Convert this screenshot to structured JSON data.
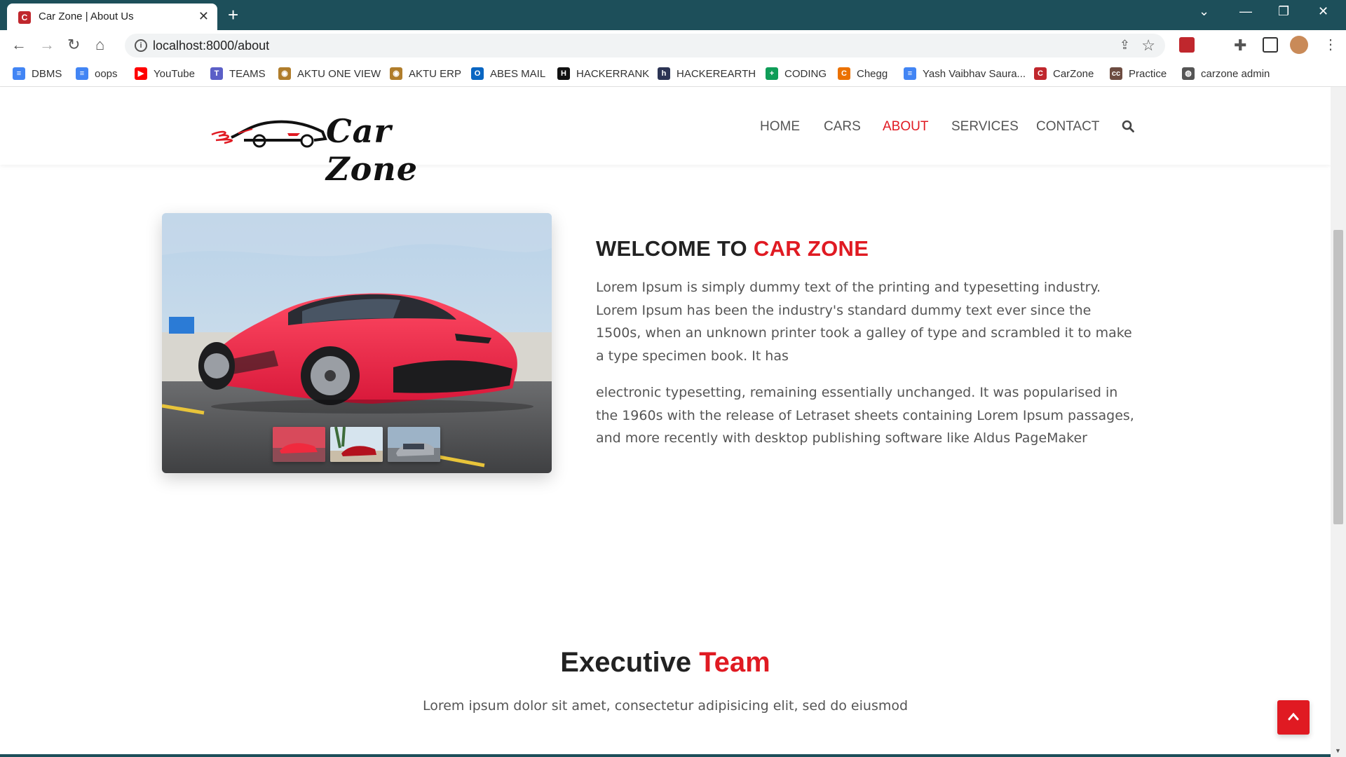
{
  "browser": {
    "tab_title": "Car Zone | About Us",
    "url": "localhost:8000/about",
    "bookmarks": [
      {
        "label": "DBMS",
        "color": "#4285f4",
        "glyph": "≡"
      },
      {
        "label": "oops",
        "color": "#4285f4",
        "glyph": "≡"
      },
      {
        "label": "YouTube",
        "color": "#ff0000",
        "glyph": "▶"
      },
      {
        "label": "TEAMS",
        "color": "#5b5fc7",
        "glyph": "T"
      },
      {
        "label": "AKTU ONE VIEW",
        "color": "#b07d2b",
        "glyph": "◉"
      },
      {
        "label": "AKTU ERP",
        "color": "#b07d2b",
        "glyph": "◉"
      },
      {
        "label": "ABES MAIL",
        "color": "#0a66c2",
        "glyph": "O"
      },
      {
        "label": "HACKERRANK",
        "color": "#111111",
        "glyph": "H"
      },
      {
        "label": "HACKEREARTH",
        "color": "#2c3454",
        "glyph": "h"
      },
      {
        "label": "CODING",
        "color": "#0f9d58",
        "glyph": "+"
      },
      {
        "label": "Chegg",
        "color": "#eb7100",
        "glyph": "C"
      },
      {
        "label": "Yash Vaibhav Saura...",
        "color": "#4285f4",
        "glyph": "≡"
      },
      {
        "label": "CarZone",
        "color": "#c0272d",
        "glyph": "C"
      },
      {
        "label": "Practice",
        "color": "#6d4c41",
        "glyph": "cc"
      },
      {
        "label": "carzone admin",
        "color": "#555555",
        "glyph": "◍"
      }
    ]
  },
  "site": {
    "brand": "Car Zone",
    "nav": [
      "HOME",
      "CARS",
      "ABOUT",
      "SERVICES",
      "CONTACT"
    ],
    "active_nav": "ABOUT",
    "accent": "#e01a22"
  },
  "about": {
    "heading_prefix": "WELCOME TO",
    "heading_accent": "CAR ZONE",
    "paragraph_1": "Lorem Ipsum is simply dummy text of the printing and typesetting industry. Lorem Ipsum has been the industry's standard dummy text ever since the 1500s, when an unknown printer took a galley of type and scrambled it to make a type specimen book. It has",
    "paragraph_2": "electronic typesetting, remaining essentially unchanged. It was popularised in the 1960s with the release of Letraset sheets containing Lorem Ipsum passages, and more recently with desktop publishing software like Aldus PageMaker"
  },
  "team": {
    "title_prefix": "Executive",
    "title_accent": "Team",
    "subtitle": "Lorem ipsum dolor sit amet, consectetur adipisicing elit, sed do eiusmod"
  }
}
